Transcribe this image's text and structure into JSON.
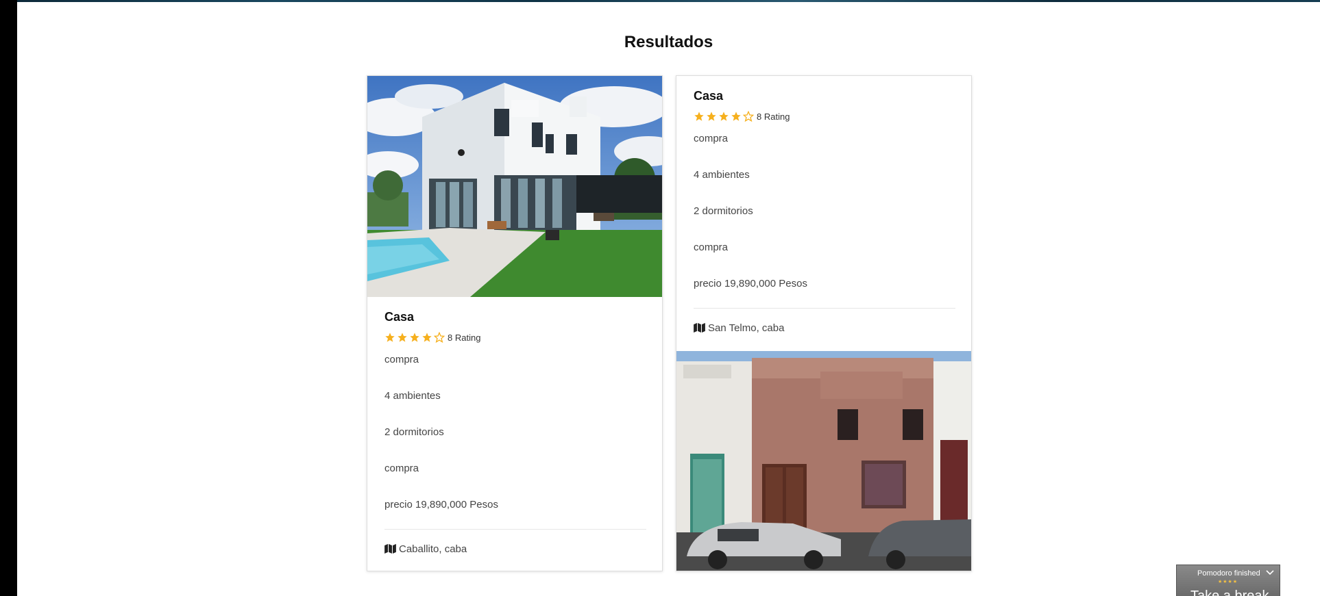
{
  "section": {
    "title": "Resultados"
  },
  "colors": {
    "star": "#f6b01e",
    "accent": "#333333"
  },
  "listings": [
    {
      "title": "Casa",
      "stars_filled": 4,
      "stars_total": 5,
      "rating_label": "8 Rating",
      "details": [
        "compra",
        "4 ambientes",
        "2 dormitorios",
        "compra",
        "precio 19,890,000 Pesos"
      ],
      "location": "Caballito, caba",
      "location_icon": "map-icon",
      "image_alt": "modern white house with pool and lawn"
    },
    {
      "title": "Casa",
      "stars_filled": 4,
      "stars_total": 5,
      "rating_label": "8 Rating",
      "details": [
        "compra",
        "4 ambientes",
        "2 dormitorios",
        "compra",
        "precio 19,890,000 Pesos"
      ],
      "location": "San Telmo, caba",
      "location_icon": "map-icon",
      "image_alt": "old brick townhouse facade with parked cars"
    }
  ],
  "pomodoro": {
    "title": "Pomodoro finished",
    "stars": "★★★★",
    "message": "Take a break"
  }
}
